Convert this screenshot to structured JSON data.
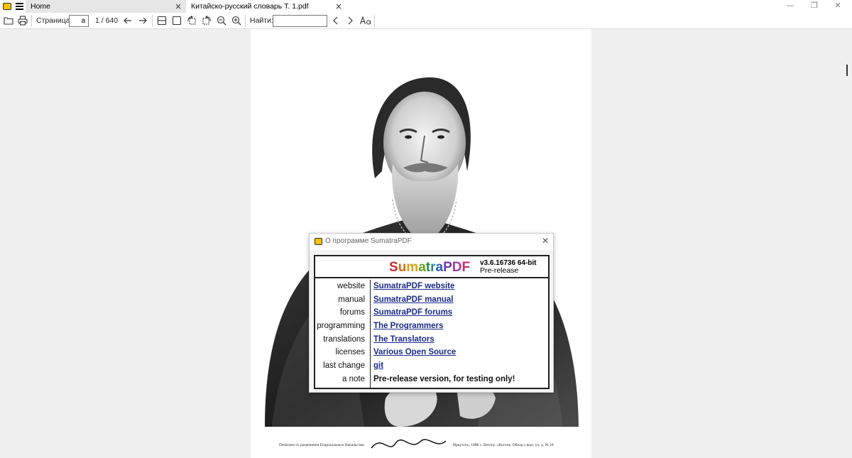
{
  "tabs": [
    {
      "label": "Home"
    },
    {
      "label": "Китайско-русский словарь Т. 1.pdf"
    }
  ],
  "toolbar": {
    "page_label": "Страница:",
    "page_value": "a",
    "page_count": "1 / 640",
    "find_label": "Найти:",
    "find_value": ""
  },
  "page": {
    "caption_left": "Печатано съ разрешенія Епархіальнаго Начальства.",
    "caption_right": "Иркутскъ, 1888 г. Литогр. «Восток. Обозр.» вып. уч. д. № 18"
  },
  "dialog": {
    "title": "О программе SumatraPDF",
    "brand": [
      "S",
      "u",
      "m",
      "a",
      "t",
      "r",
      "a",
      "P",
      "D",
      "F"
    ],
    "brand_colors": [
      "#c03030",
      "#d26a1c",
      "#d4a418",
      "#6a9f20",
      "#2a8c4a",
      "#2a8ca0",
      "#2a5fb0",
      "#6a3aa8",
      "#a63aa0",
      "#c03070"
    ],
    "version": "v3.6.16736 64-bit",
    "release": "Pre-release",
    "rows": [
      {
        "label": "website",
        "value": "SumatraPDF website"
      },
      {
        "label": "manual",
        "value": "SumatraPDF manual"
      },
      {
        "label": "forums",
        "value": "SumatraPDF forums"
      },
      {
        "label": "programming",
        "value": "The Programmers"
      },
      {
        "label": "translations",
        "value": "The Translators"
      },
      {
        "label": "licenses",
        "value": "Various Open Source"
      },
      {
        "label": "last change",
        "value": "git "
      },
      {
        "label": "a note",
        "value": "Pre-release version, for testing only!"
      }
    ]
  },
  "colors": {
    "link": "#1a2a8a",
    "accent": "#f2c200"
  }
}
